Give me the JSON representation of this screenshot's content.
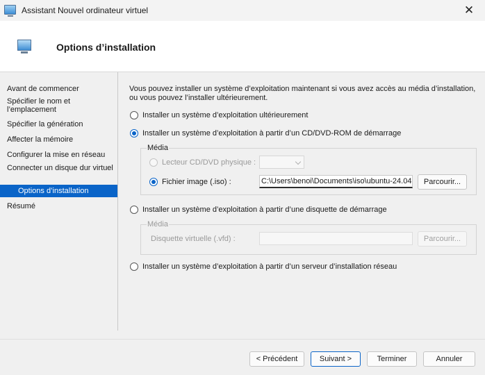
{
  "window": {
    "title": "Assistant Nouvel ordinateur virtuel",
    "close_glyph": "✕"
  },
  "header": {
    "title": "Options d’installation"
  },
  "sidebar": {
    "items": [
      {
        "label": "Avant de commencer"
      },
      {
        "label": "Spécifier le nom et l’emplacement"
      },
      {
        "label": "Spécifier la génération"
      },
      {
        "label": "Affecter la mémoire"
      },
      {
        "label": "Configurer la mise en réseau"
      },
      {
        "label": "Connecter un disque dur virtuel"
      },
      {
        "label": "Options d’installation",
        "active": true
      },
      {
        "label": "Résumé"
      }
    ]
  },
  "main": {
    "intro": "Vous pouvez installer un système d’exploitation maintenant si vous avez accès au média d’installation, ou vous pouvez l’installer ultérieurement.",
    "options": {
      "later": "Installer un système d’exploitation ultérieurement",
      "cdrom": "Installer un système d’exploitation à partir d’un CD/DVD-ROM de démarrage",
      "floppy": "Installer un système d’exploitation à partir d’une disquette de démarrage",
      "network": "Installer un système d’exploitation à partir d’un serveur d’installation réseau"
    },
    "selected_option": "cdrom",
    "cd_group": {
      "title": "Média",
      "physical_label": "Lecteur CD/DVD physique :",
      "physical_value": "",
      "image_label": "Fichier image (.iso) :",
      "image_value": "C:\\Users\\benoi\\Documents\\iso\\ubuntu-24.04",
      "browse_label": "Parcourir..."
    },
    "floppy_group": {
      "title": "Média",
      "vfd_label": "Disquette virtuelle (.vfd) :",
      "vfd_value": "",
      "browse_label": "Parcourir..."
    }
  },
  "footer": {
    "prev": "< Précédent",
    "next": "Suivant >",
    "finish": "Terminer",
    "cancel": "Annuler"
  }
}
